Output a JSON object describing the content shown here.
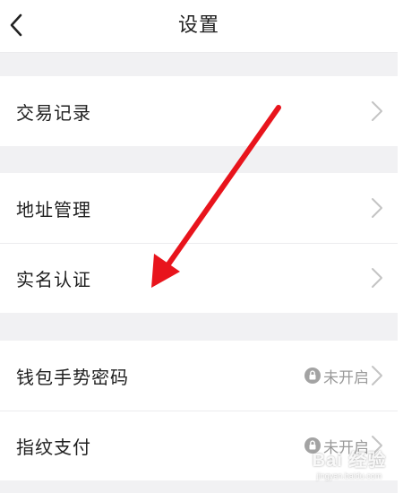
{
  "header": {
    "title": "设置",
    "back_icon": "chevron-left-icon"
  },
  "groups": [
    {
      "items": [
        {
          "label": "交易记录",
          "icon": "chevron-right-icon"
        }
      ]
    },
    {
      "items": [
        {
          "label": "地址管理",
          "icon": "chevron-right-icon"
        },
        {
          "label": "实名认证",
          "icon": "chevron-right-icon"
        }
      ]
    },
    {
      "items": [
        {
          "label": "钱包手势密码",
          "status": "未开启",
          "status_icon": "lock-icon",
          "icon": "chevron-right-icon"
        },
        {
          "label": "指纹支付",
          "status": "未开启",
          "status_icon": "lock-icon",
          "icon": "chevron-right-icon"
        }
      ]
    }
  ],
  "annotation": {
    "type": "arrow",
    "color": "#e8141c"
  },
  "watermark": {
    "brand": "Bai 经验",
    "sub": "jingyan.baidu.com"
  },
  "colors": {
    "background": "#f1f1f3",
    "row": "#ffffff",
    "muted": "#9a9a9a",
    "chevron": "#c4c4c4"
  }
}
